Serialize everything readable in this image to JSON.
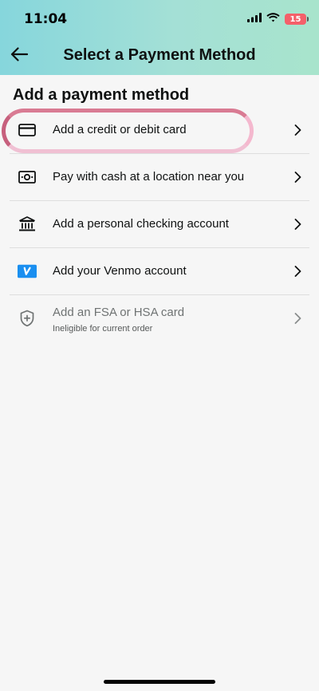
{
  "status_bar": {
    "time": "11:04",
    "battery": "15",
    "icons": [
      "cellular-signal-icon",
      "wifi-icon",
      "battery-charging-icon"
    ]
  },
  "nav": {
    "title": "Select a Payment Method",
    "back_icon": "arrow-left-icon"
  },
  "section_title": "Add a payment method",
  "items": [
    {
      "label": "Add a credit or debit card",
      "icon": "credit-card-icon",
      "enabled": true
    },
    {
      "label": "Pay with cash at a location near you",
      "icon": "cash-icon",
      "enabled": true
    },
    {
      "label": "Add a personal checking account",
      "icon": "bank-icon",
      "enabled": true
    },
    {
      "label": "Add your Venmo account",
      "icon": "venmo-icon",
      "enabled": true
    },
    {
      "label": "Add an FSA or HSA card",
      "sublabel": "Ineligible for current order",
      "icon": "shield-plus-icon",
      "enabled": false
    }
  ],
  "colors": {
    "header_gradient_start": "#86d6dc",
    "header_gradient_end": "#a8e4cc",
    "background": "#f6f6f6",
    "venmo_blue": "#1a8ff0",
    "highlight_ring": "#d97b93",
    "battery_low": "#f4606a"
  }
}
